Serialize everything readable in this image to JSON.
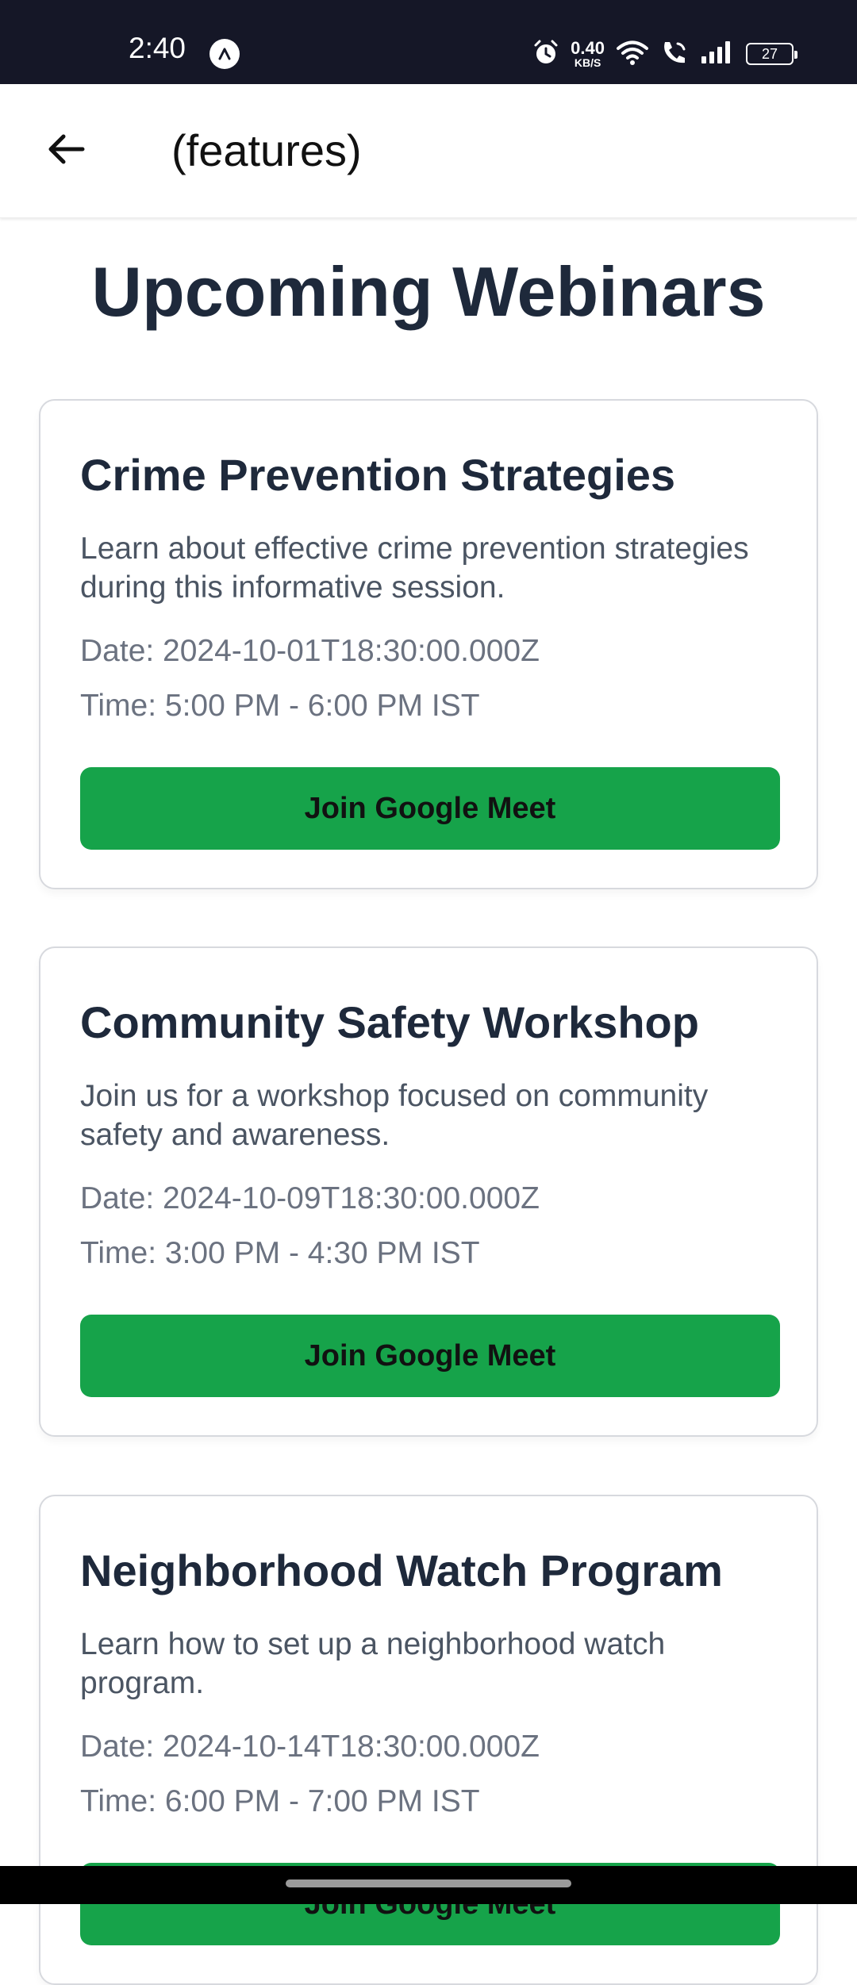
{
  "status_bar": {
    "time": "2:40",
    "net_speed_value": "0.40",
    "net_speed_unit": "KB/S",
    "battery": "27",
    "icons": [
      "app-logo-icon",
      "alarm-icon",
      "wifi-icon",
      "wifi-call-icon",
      "signal-icon",
      "battery-icon"
    ]
  },
  "header": {
    "back_icon": "arrow-left-icon",
    "title": "(features)"
  },
  "main": {
    "title": "Upcoming Webinars",
    "webinars": [
      {
        "title": "Crime Prevention Strategies",
        "description": "Learn about effective crime prevention strategies during this informative session.",
        "date": "Date: 2024-10-01T18:30:00.000Z",
        "time": "Time: 5:00 PM - 6:00 PM IST",
        "button_label": "Join Google Meet"
      },
      {
        "title": "Community Safety Workshop",
        "description": "Join us for a workshop focused on community safety and awareness.",
        "date": "Date: 2024-10-09T18:30:00.000Z",
        "time": "Time: 3:00 PM - 4:30 PM IST",
        "button_label": "Join Google Meet"
      },
      {
        "title": "Neighborhood Watch Program",
        "description": "Learn how to set up a neighborhood watch program.",
        "date": "Date: 2024-10-14T18:30:00.000Z",
        "time": "Time: 6:00 PM - 7:00 PM IST",
        "button_label": "Join Google Meet"
      }
    ]
  },
  "colors": {
    "status_bar_bg": "#151727",
    "accent_green": "#16a34a",
    "heading_text": "#1e293b",
    "muted_text": "#6b7280",
    "card_border": "#d7d9de"
  }
}
